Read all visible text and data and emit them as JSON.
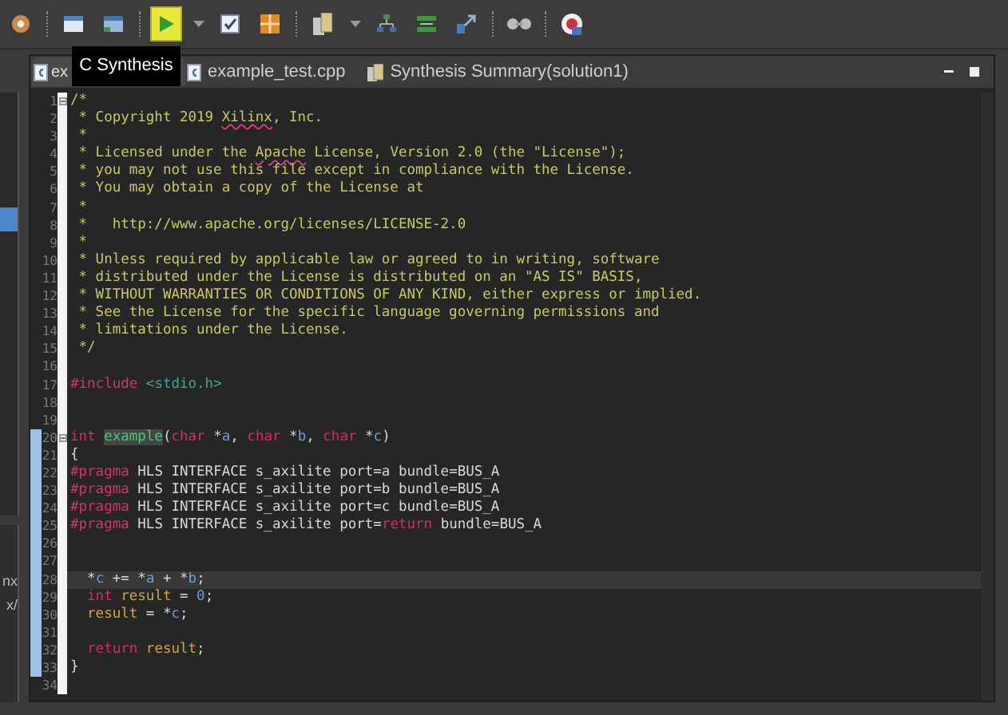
{
  "toolbar": [
    {
      "buttons": [
        {
          "kind": "gear",
          "hovered": false
        }
      ]
    },
    {
      "buttons": [
        {
          "kind": "calendar",
          "hovered": false
        },
        {
          "kind": "window",
          "hovered": false
        }
      ]
    },
    {
      "buttons": [
        {
          "kind": "run",
          "hovered": true
        },
        {
          "kind": "caret",
          "hovered": false
        },
        {
          "kind": "check",
          "hovered": false
        },
        {
          "kind": "grid",
          "hovered": false
        }
      ]
    },
    {
      "buttons": [
        {
          "kind": "report",
          "hovered": false
        },
        {
          "kind": "caret",
          "hovered": false
        },
        {
          "kind": "tree",
          "hovered": false
        },
        {
          "kind": "compare",
          "hovered": false
        },
        {
          "kind": "export",
          "hovered": false
        }
      ]
    },
    {
      "buttons": [
        {
          "kind": "glasses",
          "hovered": false
        }
      ]
    },
    {
      "buttons": [
        {
          "kind": "help",
          "hovered": false
        }
      ]
    }
  ],
  "tooltip": "C Synthesis",
  "left_panel": {
    "texts": [
      "nx",
      "x/"
    ]
  },
  "tabs": [
    {
      "label": "ex",
      "kind": "source",
      "selected": true
    },
    {
      "label": "example_test.cpp",
      "kind": "source",
      "selected": false
    },
    {
      "label": "Synthesis Summary(solution1)",
      "kind": "report",
      "selected": false
    }
  ],
  "lines": [
    {
      "number": "1",
      "fold": true,
      "marked": false,
      "current": false,
      "segments": [
        {
          "kind": "comment",
          "text": "/*"
        }
      ]
    },
    {
      "number": "2",
      "fold": false,
      "marked": false,
      "current": false,
      "segments": [
        {
          "kind": "comment",
          "text": " * Copyright 2019 "
        },
        {
          "kind": "misspelled",
          "text": "Xilinx"
        },
        {
          "kind": "comment",
          "text": ", Inc."
        }
      ]
    },
    {
      "number": "3",
      "fold": false,
      "marked": false,
      "current": false,
      "segments": [
        {
          "kind": "comment",
          "text": " *"
        }
      ]
    },
    {
      "number": "4",
      "fold": false,
      "marked": false,
      "current": false,
      "segments": [
        {
          "kind": "comment",
          "text": " * Licensed under the "
        },
        {
          "kind": "misspelled",
          "text": "Apache"
        },
        {
          "kind": "comment",
          "text": " License, Version 2.0 (the \"License\");"
        }
      ]
    },
    {
      "number": "5",
      "fold": false,
      "marked": false,
      "current": false,
      "segments": [
        {
          "kind": "comment",
          "text": " * you may not use this file except in compliance with the License."
        }
      ]
    },
    {
      "number": "6",
      "fold": false,
      "marked": false,
      "current": false,
      "segments": [
        {
          "kind": "comment",
          "text": " * You may obtain a copy of the License at"
        }
      ]
    },
    {
      "number": "7",
      "fold": false,
      "marked": false,
      "current": false,
      "segments": [
        {
          "kind": "comment",
          "text": " *"
        }
      ]
    },
    {
      "number": "8",
      "fold": false,
      "marked": false,
      "current": false,
      "segments": [
        {
          "kind": "comment",
          "text": " *   http://www.apache.org/licenses/LICENSE-2.0"
        }
      ]
    },
    {
      "number": "9",
      "fold": false,
      "marked": false,
      "current": false,
      "segments": [
        {
          "kind": "comment",
          "text": " *"
        }
      ]
    },
    {
      "number": "10",
      "fold": false,
      "marked": false,
      "current": false,
      "segments": [
        {
          "kind": "comment",
          "text": " * Unless required by applicable law or agreed to in writing, software"
        }
      ]
    },
    {
      "number": "11",
      "fold": false,
      "marked": false,
      "current": false,
      "segments": [
        {
          "kind": "comment",
          "text": " * distributed under the License is distributed on an \"AS IS\" BASIS,"
        }
      ]
    },
    {
      "number": "12",
      "fold": false,
      "marked": false,
      "current": false,
      "segments": [
        {
          "kind": "comment",
          "text": " * WITHOUT WARRANTIES OR CONDITIONS OF ANY KIND, either express or implied."
        }
      ]
    },
    {
      "number": "13",
      "fold": false,
      "marked": false,
      "current": false,
      "segments": [
        {
          "kind": "comment",
          "text": " * See the License for the specific language governing permissions and"
        }
      ]
    },
    {
      "number": "14",
      "fold": false,
      "marked": false,
      "current": false,
      "segments": [
        {
          "kind": "comment",
          "text": " * limitations under the License."
        }
      ]
    },
    {
      "number": "15",
      "fold": false,
      "marked": false,
      "current": false,
      "segments": [
        {
          "kind": "comment",
          "text": " */"
        }
      ]
    },
    {
      "number": "16",
      "fold": false,
      "marked": false,
      "current": false
    },
    {
      "number": "17",
      "fold": false,
      "marked": false,
      "current": false,
      "segments": [
        {
          "kind": "preproc",
          "text": "#include"
        },
        {
          "kind": "include",
          "text": " <stdio.h>"
        }
      ]
    },
    {
      "number": "18",
      "fold": false,
      "marked": false,
      "current": false
    },
    {
      "number": "19",
      "fold": false,
      "marked": false,
      "current": false
    },
    {
      "number": "20",
      "fold": true,
      "marked": true,
      "current": false,
      "segments": [
        {
          "kind": "keyword",
          "text": "int "
        },
        {
          "kind": "function",
          "text": "example"
        },
        {
          "kind": "plain",
          "text": "("
        },
        {
          "kind": "keyword",
          "text": "char"
        },
        {
          "kind": "plain",
          "text": " *"
        },
        {
          "kind": "param",
          "text": "a"
        },
        {
          "kind": "plain",
          "text": ", "
        },
        {
          "kind": "keyword",
          "text": "char"
        },
        {
          "kind": "plain",
          "text": " *"
        },
        {
          "kind": "param",
          "text": "b"
        },
        {
          "kind": "plain",
          "text": ", "
        },
        {
          "kind": "keyword",
          "text": "char"
        },
        {
          "kind": "plain",
          "text": " *"
        },
        {
          "kind": "param",
          "text": "c"
        },
        {
          "kind": "plain",
          "text": ")"
        }
      ]
    },
    {
      "number": "21",
      "fold": false,
      "marked": true,
      "current": false,
      "segments": [
        {
          "kind": "plain",
          "text": "{"
        }
      ]
    },
    {
      "number": "22",
      "fold": false,
      "marked": true,
      "current": false,
      "segments": [
        {
          "kind": "preproc",
          "text": "#pragma"
        },
        {
          "kind": "plain",
          "text": " HLS INTERFACE s_axilite port=a bundle=BUS_A"
        }
      ]
    },
    {
      "number": "23",
      "fold": false,
      "marked": true,
      "current": false,
      "segments": [
        {
          "kind": "preproc",
          "text": "#pragma"
        },
        {
          "kind": "plain",
          "text": " HLS INTERFACE s_axilite port=b bundle=BUS_A"
        }
      ]
    },
    {
      "number": "24",
      "fold": false,
      "marked": true,
      "current": false,
      "segments": [
        {
          "kind": "preproc",
          "text": "#pragma"
        },
        {
          "kind": "plain",
          "text": " HLS INTERFACE s_axilite port=c bundle=BUS_A"
        }
      ]
    },
    {
      "number": "25",
      "fold": false,
      "marked": true,
      "current": false,
      "segments": [
        {
          "kind": "preproc",
          "text": "#pragma"
        },
        {
          "kind": "plain",
          "text": " HLS INTERFACE s_axilite port="
        },
        {
          "kind": "keyword",
          "text": "return"
        },
        {
          "kind": "plain",
          "text": " bundle=BUS_A"
        }
      ]
    },
    {
      "number": "26",
      "fold": false,
      "marked": true,
      "current": false
    },
    {
      "number": "27",
      "fold": false,
      "marked": true,
      "current": false
    },
    {
      "number": "28",
      "fold": false,
      "marked": true,
      "current": true,
      "segments": [
        {
          "kind": "plain",
          "text": "  *"
        },
        {
          "kind": "param",
          "text": "c"
        },
        {
          "kind": "plain",
          "text": " += *"
        },
        {
          "kind": "param",
          "text": "a"
        },
        {
          "kind": "plain",
          "text": " + *"
        },
        {
          "kind": "param",
          "text": "b"
        },
        {
          "kind": "plain",
          "text": ";"
        }
      ]
    },
    {
      "number": "29",
      "fold": false,
      "marked": true,
      "current": false,
      "segments": [
        {
          "kind": "keyword",
          "text": "  int "
        },
        {
          "kind": "local",
          "text": "result"
        },
        {
          "kind": "plain",
          "text": " = "
        },
        {
          "kind": "number",
          "text": "0"
        },
        {
          "kind": "plain",
          "text": ";"
        }
      ]
    },
    {
      "number": "30",
      "fold": false,
      "marked": true,
      "current": false,
      "segments": [
        {
          "kind": "local",
          "text": "  result"
        },
        {
          "kind": "plain",
          "text": " = *"
        },
        {
          "kind": "param",
          "text": "c"
        },
        {
          "kind": "plain",
          "text": ";"
        }
      ]
    },
    {
      "number": "31",
      "fold": false,
      "marked": true,
      "current": false
    },
    {
      "number": "32",
      "fold": false,
      "marked": true,
      "current": false,
      "segments": [
        {
          "kind": "keyword",
          "text": "  return "
        },
        {
          "kind": "local",
          "text": "result"
        },
        {
          "kind": "plain",
          "text": ";"
        }
      ]
    },
    {
      "number": "33",
      "fold": false,
      "marked": true,
      "current": false,
      "segments": [
        {
          "kind": "plain",
          "text": "}"
        }
      ]
    },
    {
      "number": "34",
      "fold": false,
      "marked": false,
      "current": false
    }
  ]
}
